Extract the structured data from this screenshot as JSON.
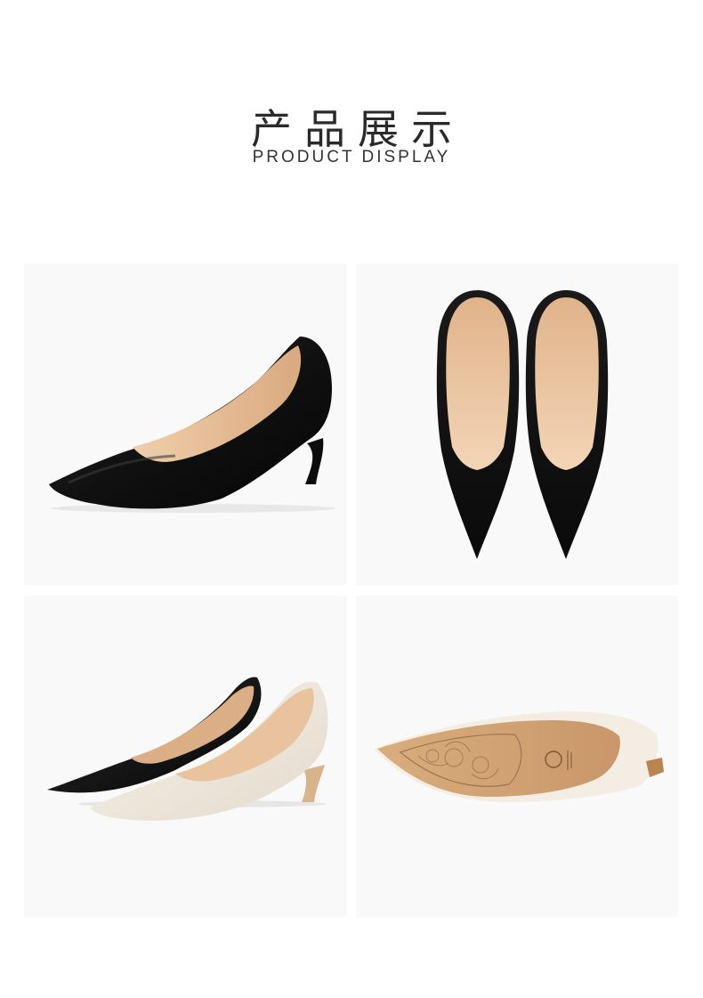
{
  "header": {
    "title_zh": "产品展示",
    "title_en": "PRODUCT DISPLAY"
  },
  "gallery": [
    {
      "id": "photo-side-black",
      "desc_icon": "black-pump-side-view-photo"
    },
    {
      "id": "photo-top-black-pair",
      "desc_icon": "black-pump-pair-top-view-photo"
    },
    {
      "id": "photo-black-and-cream-pair",
      "desc_icon": "black-and-cream-pump-photo"
    },
    {
      "id": "photo-sole-cream",
      "desc_icon": "cream-pump-sole-photo"
    }
  ],
  "colors": {
    "tile_bg": "#f9f9f9",
    "black_leather": "#141414",
    "nude_lining": "#e2b892",
    "cream_leather": "#efe8dc",
    "sole_tan": "#d3a777"
  }
}
